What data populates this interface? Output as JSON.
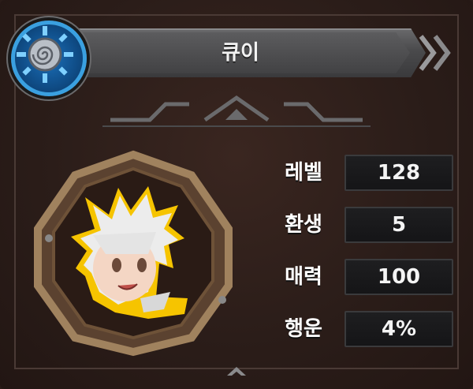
{
  "character": {
    "name": "큐이"
  },
  "stats": [
    {
      "label": "레벨",
      "value": "128"
    },
    {
      "label": "환생",
      "value": "5"
    },
    {
      "label": "매력",
      "value": "100"
    },
    {
      "label": "행운",
      "value": "4%"
    }
  ],
  "icons": {
    "emblem": "spiral-emblem-icon",
    "next": "double-chevron-right-icon",
    "expand": "chevron-up-icon"
  },
  "colors": {
    "background": "#2b1d19",
    "banner": "#4a4a4c",
    "emblem_blue": "#1b6fb8",
    "portrait_frame": "#8a6e4e",
    "value_box": "#1b1b1d"
  }
}
